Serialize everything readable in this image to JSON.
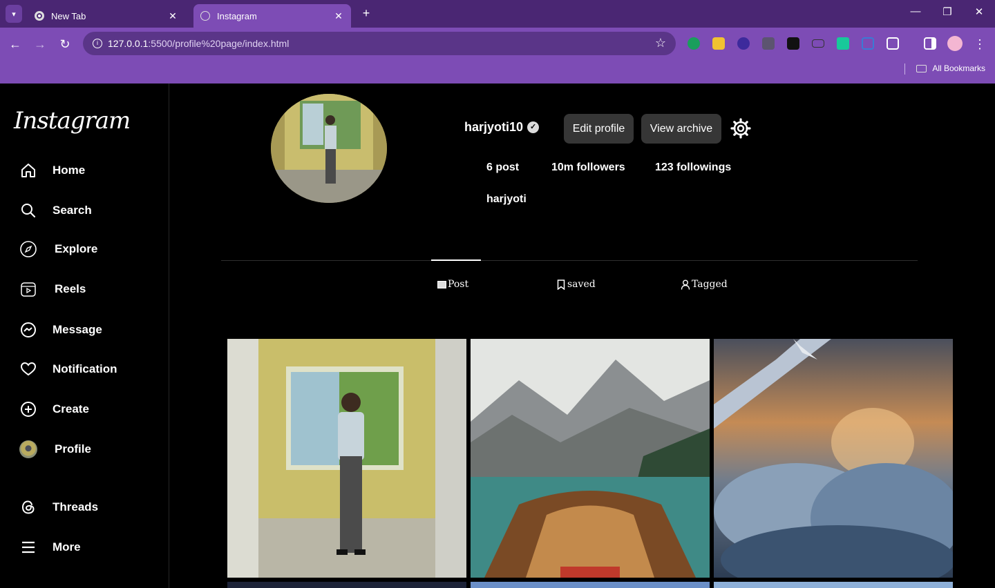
{
  "browser": {
    "tabs": [
      {
        "title": "New Tab",
        "active": false
      },
      {
        "title": "Instagram",
        "active": true
      }
    ],
    "url_host": "127.0.0.1",
    "url_path": ":5500/profile%20page/index.html",
    "bookmarks_label": "All Bookmarks",
    "accent_color": "#7d4cb5"
  },
  "sidebar": {
    "logo": "Instagram",
    "items": [
      {
        "label": "Home",
        "icon": "home-icon"
      },
      {
        "label": "Search",
        "icon": "search-icon"
      },
      {
        "label": "Explore",
        "icon": "compass-icon"
      },
      {
        "label": "Reels",
        "icon": "reels-icon"
      },
      {
        "label": "Message",
        "icon": "messenger-icon"
      },
      {
        "label": "Notification",
        "icon": "heart-icon"
      },
      {
        "label": "Create",
        "icon": "plus-circle-icon"
      },
      {
        "label": "Profile",
        "icon": "avatar"
      },
      {
        "label": "Threads",
        "icon": "threads-icon"
      },
      {
        "label": "More",
        "icon": "menu-icon"
      }
    ]
  },
  "profile": {
    "username": "harjyoti10",
    "edit_label": "Edit profile",
    "archive_label": "View archive",
    "posts": "6 post",
    "followers": "10m followers",
    "following": "123 followings",
    "full_name": "harjyoti"
  },
  "tabs": {
    "post": "Post",
    "saved": "saved",
    "tagged": "Tagged"
  }
}
